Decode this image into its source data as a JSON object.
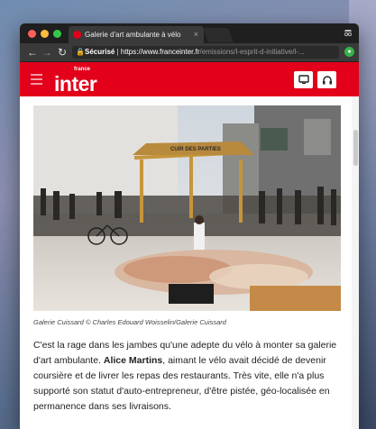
{
  "browser": {
    "tab_title": "Galerie d'art ambulante à vélo",
    "tab_close": "×",
    "secure_label": "Sécurisé",
    "url_host": "https://www.franceinter.fr",
    "url_path": "/emissions/l-esprit-d-initiative/l-..."
  },
  "site": {
    "logo_small": "france",
    "logo_main": "inter"
  },
  "article": {
    "image_caption": "Galerie Cuissard © Charles Edouard Woisselin/Galerie Cuissard",
    "stand_sign": "CUIR DES PARTIES",
    "para_before": "C'est la rage dans les jambes qu'une adepte du vélo à monter sa galerie d'art ambulante. ",
    "para_name": "Alice Martins",
    "para_after": ", aimant le vélo avait décidé de devenir coursière et de livrer les repas des restaurants. Très vite, elle n'a plus supporté son statut d'auto-entrepreneur, d'être pistée, géo-localisée en permanence dans ses livraisons."
  },
  "colors": {
    "brand_red": "#e2001a",
    "chrome_dark": "#1f1f1f"
  },
  "icons": [
    "close-icon",
    "back-arrow-icon",
    "forward-arrow-icon",
    "reload-icon",
    "lock-icon",
    "incognito-icon",
    "extension-icon",
    "hamburger-icon",
    "tv-icon",
    "headphones-icon"
  ]
}
